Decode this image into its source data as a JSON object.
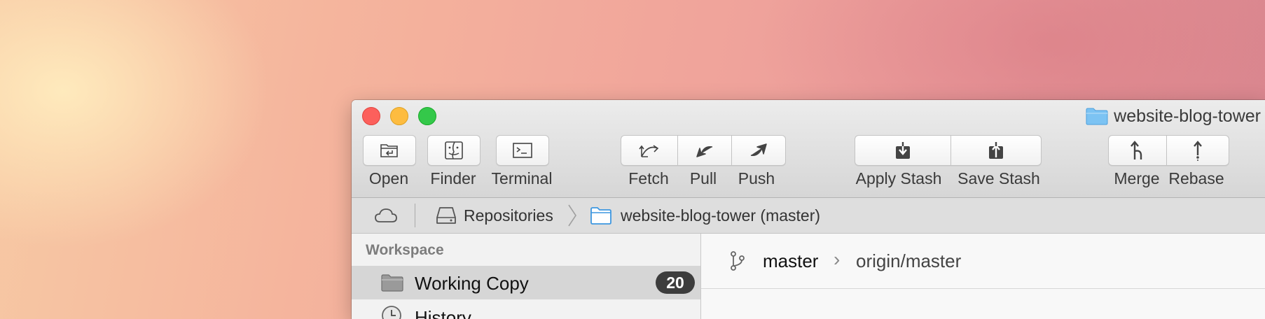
{
  "window": {
    "title": "website-blog-tower",
    "title_icon": "folder-icon"
  },
  "toolbar": {
    "open": "Open",
    "finder": "Finder",
    "terminal": "Terminal",
    "fetch": "Fetch",
    "pull": "Pull",
    "push": "Push",
    "apply_stash": "Apply Stash",
    "save_stash": "Save Stash",
    "merge": "Merge",
    "rebase": "Rebase"
  },
  "pathbar": {
    "repositories": "Repositories",
    "repo": "website-blog-tower (master)"
  },
  "sidebar": {
    "section": "Workspace",
    "items": [
      {
        "label": "Working Copy",
        "badge": "20",
        "icon": "folder-icon",
        "selected": true
      },
      {
        "label": "History",
        "icon": "clock-icon"
      }
    ]
  },
  "main": {
    "branch": "master",
    "remote": "origin/master"
  },
  "colors": {
    "close": "#fc605c",
    "minimize": "#fdbc40",
    "maximize": "#34c84a",
    "folder_blue": "#6bb8f0",
    "selected_row": "#d6d6d6",
    "badge": "#3d3d3d"
  }
}
